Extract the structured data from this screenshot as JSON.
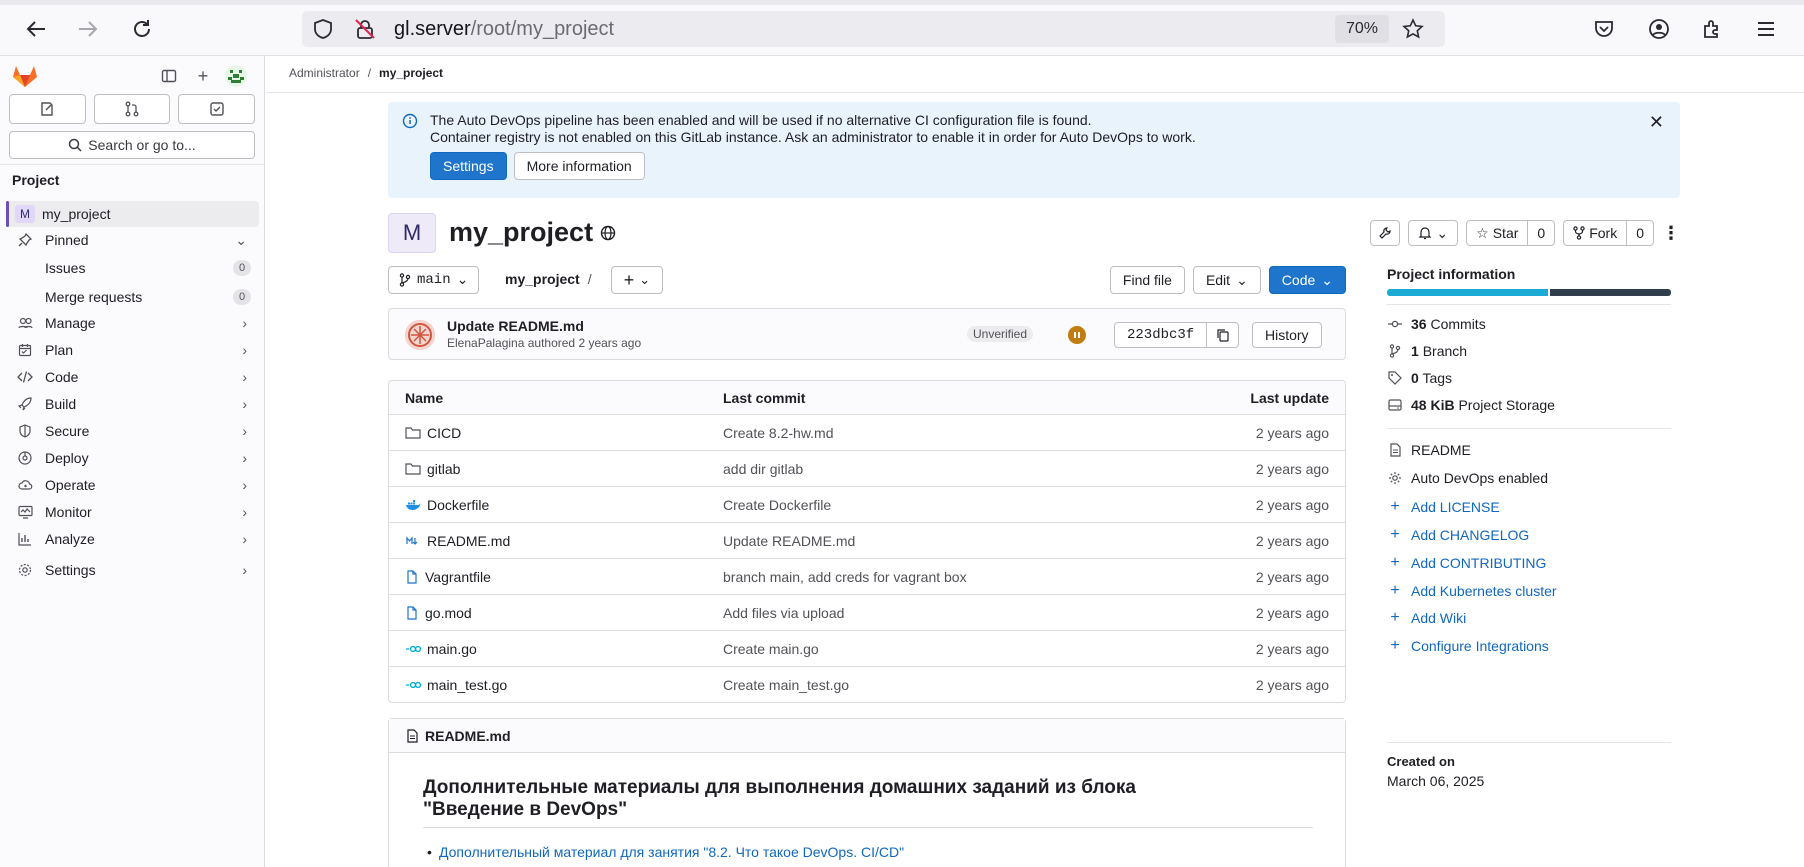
{
  "browser": {
    "url_host": "gl.server",
    "url_path": "/root/my_project",
    "zoom": "70%"
  },
  "sidebar": {
    "section": "Project",
    "search_placeholder": "Search or go to...",
    "project_item": {
      "avatar": "M",
      "label": "my_project"
    },
    "pinned": "Pinned",
    "pinned_items": [
      {
        "label": "Issues",
        "count": "0"
      },
      {
        "label": "Merge requests",
        "count": "0"
      }
    ],
    "nav": [
      {
        "label": "Manage",
        "icon": "users-icon"
      },
      {
        "label": "Plan",
        "icon": "planning-icon"
      },
      {
        "label": "Code",
        "icon": "code-icon"
      },
      {
        "label": "Build",
        "icon": "rocket-icon"
      },
      {
        "label": "Secure",
        "icon": "shield-icon"
      },
      {
        "label": "Deploy",
        "icon": "deployments-icon"
      },
      {
        "label": "Operate",
        "icon": "cloud-icon"
      },
      {
        "label": "Monitor",
        "icon": "monitor-icon"
      },
      {
        "label": "Analyze",
        "icon": "chart-icon"
      },
      {
        "label": "Settings",
        "icon": "settings-icon"
      }
    ]
  },
  "breadcrumb": {
    "parent": "Administrator",
    "separator": "/",
    "current": "my_project"
  },
  "alert": {
    "line1": "The Auto DevOps pipeline has been enabled and will be used if no alternative CI configuration file is found.",
    "line2": "Container registry is not enabled on this GitLab instance. Ask an administrator to enable it in order for Auto DevOps to work.",
    "settings_btn": "Settings",
    "more_btn": "More information"
  },
  "project": {
    "avatar": "M",
    "name": "my_project",
    "star_label": "Star",
    "star_count": "0",
    "fork_label": "Fork",
    "fork_count": "0"
  },
  "repo": {
    "branch": "main",
    "path": "my_project",
    "path_sep": "/",
    "find_file": "Find file",
    "edit": "Edit",
    "code": "Code"
  },
  "commit": {
    "title": "Update README.md",
    "meta": "ElenaPalagina authored 2 years ago",
    "badge": "Unverified",
    "sha": "223dbc3f",
    "history": "History"
  },
  "files": {
    "headers": {
      "name": "Name",
      "last_commit": "Last commit",
      "last_update": "Last update"
    },
    "rows": [
      {
        "name": "CICD",
        "type": "folder",
        "commit": "Create 8.2-hw.md",
        "updated": "2 years ago"
      },
      {
        "name": "gitlab",
        "type": "folder",
        "commit": "add dir gitlab",
        "updated": "2 years ago"
      },
      {
        "name": "Dockerfile",
        "type": "docker",
        "commit": "Create Dockerfile",
        "updated": "2 years ago"
      },
      {
        "name": "README.md",
        "type": "markdown",
        "commit": "Update README.md",
        "updated": "2 years ago"
      },
      {
        "name": "Vagrantfile",
        "type": "file",
        "commit": "branch main, add creds for vagrant box",
        "updated": "2 years ago"
      },
      {
        "name": "go.mod",
        "type": "file",
        "commit": "Add files via upload",
        "updated": "2 years ago"
      },
      {
        "name": "main.go",
        "type": "go",
        "commit": "Create main.go",
        "updated": "2 years ago"
      },
      {
        "name": "main_test.go",
        "type": "go",
        "commit": "Create main_test.go",
        "updated": "2 years ago"
      }
    ]
  },
  "readme": {
    "filename": "README.md",
    "heading_line1": "Дополнительные материалы для выполнения домашних заданий из блока",
    "heading_line2": "\"Введение в DevOps\"",
    "item1": "Дополнительный материал для занятия \"8.2. Что такое DevOps. CI/CD\""
  },
  "info": {
    "title": "Project information",
    "commits_num": "36",
    "commits_label": "Commits",
    "branch_num": "1",
    "branch_label": "Branch",
    "tags_num": "0",
    "tags_label": "Tags",
    "storage_num": "48 KiB",
    "storage_label": "Project Storage",
    "readme": "README",
    "autodevops": "Auto DevOps enabled",
    "links": [
      "Add LICENSE",
      "Add CHANGELOG",
      "Add CONTRIBUTING",
      "Add Kubernetes cluster",
      "Add Wiki",
      "Configure Integrations"
    ],
    "created_label": "Created on",
    "created_date": "March 06, 2025"
  },
  "colors": {
    "primary": "#1f75cb",
    "link": "#1068bf",
    "alert_bg": "#e9f3fc",
    "language_go": "#1aaad4",
    "language_other": "#2f3e4a"
  }
}
